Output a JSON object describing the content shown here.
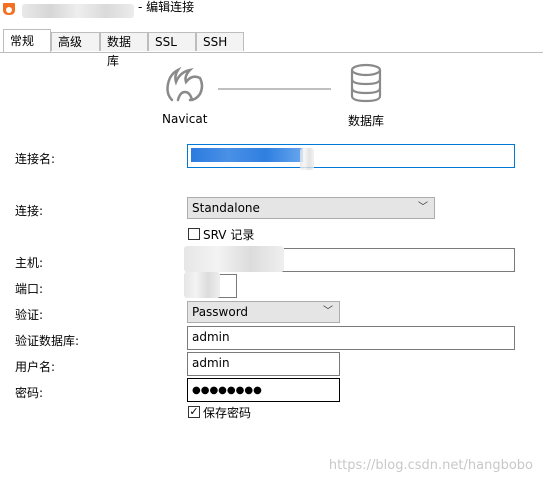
{
  "window": {
    "title": "- 编辑连接"
  },
  "tabs": [
    "常规",
    "高级",
    "数据库",
    "SSL",
    "SSH"
  ],
  "diagram": {
    "left_caption": "Navicat",
    "right_caption": "数据库"
  },
  "form": {
    "connection_name_label": "连接名:",
    "connection_label": "连接:",
    "connection_value": "Standalone",
    "srv_label": "SRV 记录",
    "host_label": "主机:",
    "port_label": "端口:",
    "auth_label": "验证:",
    "auth_value": "Password",
    "auth_db_label": "验证数据库:",
    "auth_db_value": "admin",
    "username_label": "用户名:",
    "username_value": "admin",
    "password_label": "密码:",
    "password_value": "●●●●●●●●",
    "save_password_label": "保存密码"
  },
  "watermark": "https://blog.csdn.net/hangbobo"
}
